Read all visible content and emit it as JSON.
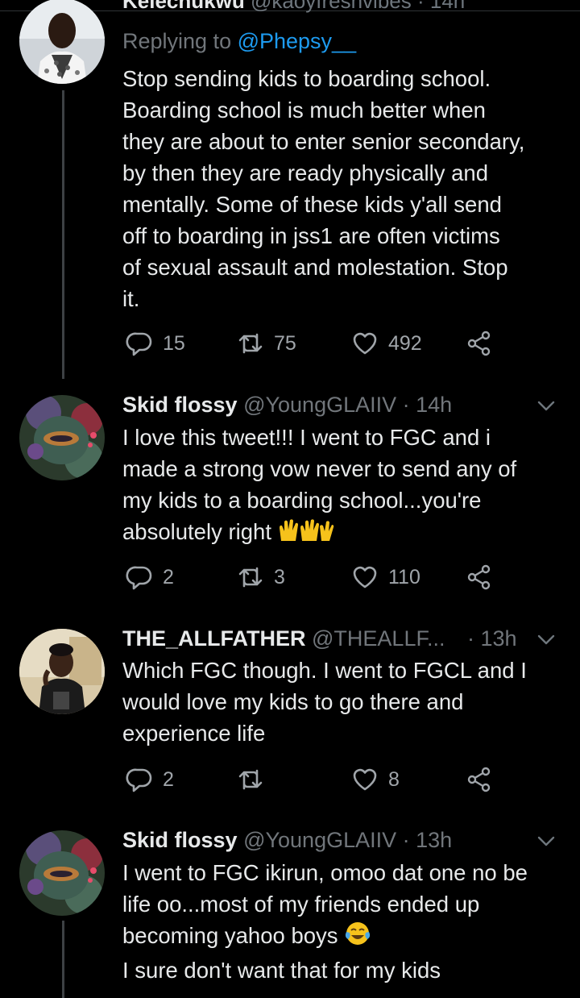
{
  "tweets": [
    {
      "reply_prefix": "Replying to ",
      "reply_to": "@Phepsy__",
      "lines": [
        "Stop sending kids to boarding school.",
        "Boarding school is much better when",
        "they are about to enter senior secondary,",
        "by then they are ready physically and",
        "mentally. Some of these kids y'all send",
        "off to boarding in jss1 are often victims",
        "of sexual assault and molestation. Stop",
        "it."
      ],
      "replies": "15",
      "retweets": "75",
      "likes": "492"
    },
    {
      "name": "Skid flossy",
      "handle": "@YoungGLAIIV",
      "time": "· 14h",
      "lines": [
        "I love this tweet!!! I went to FGC and i",
        "made a strong vow never to send any of",
        "my kids to a boarding school...you're",
        "absolutely right"
      ],
      "replies": "2",
      "retweets": "3",
      "likes": "110"
    },
    {
      "name": "THE_ALLFATHER",
      "handle": "@THEALLF...",
      "time": "· 13h",
      "lines": [
        "Which FGC though. I went to FGCL and I",
        "would love my kids to go there and",
        "experience life"
      ],
      "replies": "2",
      "retweets": "",
      "likes": "8"
    },
    {
      "name": "Skid flossy",
      "handle": "@YoungGLAIIV",
      "time": "· 13h",
      "lines": [
        "I went to FGC ikirun, omoo dat one no be",
        "life oo...most of my friends ended up",
        "becoming yahoo boys",
        "I sure don't want that for my kids"
      ]
    }
  ],
  "icons": {
    "reply": "reply-icon",
    "retweet": "retweet-icon",
    "like": "heart-icon",
    "share": "share-icon",
    "more": "chevron-down-icon",
    "raised_hands": "raised-hands-emoji",
    "tears_of_joy": "tears-of-joy-emoji"
  },
  "colors": {
    "background": "#000000",
    "text": "#e7e9ea",
    "secondary": "#71767b",
    "mention": "#1d9bf0",
    "emoji_yellow": "#f6c21b"
  }
}
